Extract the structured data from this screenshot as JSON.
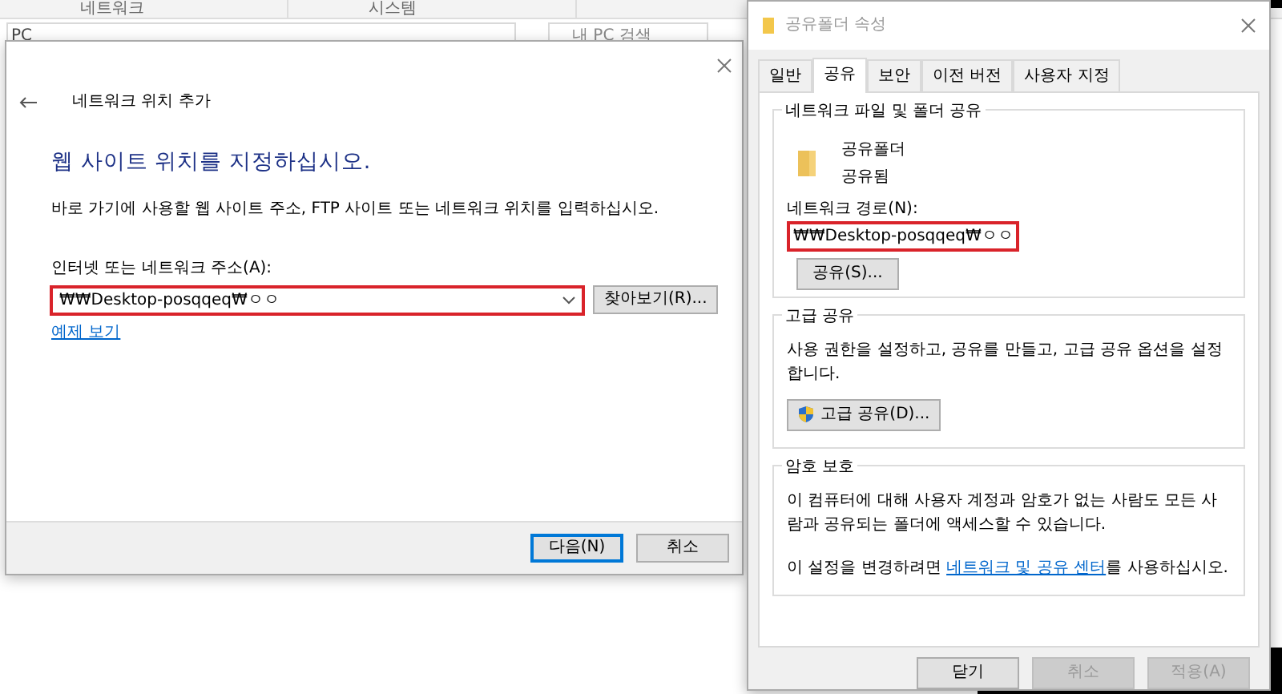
{
  "background_window": {
    "columns": [
      "네트워크",
      "시스템"
    ],
    "address": "PC",
    "search_placeholder": "내 PC 검색"
  },
  "add_location_dialog": {
    "header": "네트워크 위치 추가",
    "heading": "웹 사이트 위치를 지정하십시오.",
    "description": "바로 가기에 사용할 웹 사이트 주소, FTP 사이트 또는 네트워크 위치를 입력하십시오.",
    "address_label": "인터넷 또는 네트워크 주소(A):",
    "address_value": "₩₩Desktop-posqqeq₩ㅇㅇ",
    "address_highlighted": true,
    "browse_button": "찾아보기(R)...",
    "example_link": "예제 보기",
    "buttons": [
      {
        "label": "다음(N)",
        "default": true
      },
      {
        "label": "취소",
        "default": false
      }
    ]
  },
  "properties_dialog": {
    "title": "공유폴더 속성",
    "tabs": [
      {
        "label": "일반",
        "selected": false
      },
      {
        "label": "공유",
        "selected": true
      },
      {
        "label": "보안",
        "selected": false
      },
      {
        "label": "이전 버전",
        "selected": false
      },
      {
        "label": "사용자 지정",
        "selected": false
      }
    ],
    "network_sharing": {
      "title": "네트워크 파일 및 폴더 공유",
      "folder_name": "공유폴더",
      "status": "공유됨",
      "path_label": "네트워크 경로(N):",
      "path": "₩₩Desktop-posqqeq₩ㅇㅇ",
      "path_highlighted": true,
      "button": "공유(S)..."
    },
    "advanced_sharing": {
      "title": "고급 공유",
      "description": "사용 권한을 설정하고, 공유를 만들고, 고급 공유 옵션을 설정합니다.",
      "button": "고급 공유(D)..."
    },
    "password_protection": {
      "title": "암호 보호",
      "description": "이 컴퓨터에 대해 사용자 계정과 암호가 없는 사람도 모든 사람과 공유되는 폴더에 액세스할 수 있습니다.",
      "sentence_before": "이 설정을 변경하려면 ",
      "link": "네트워크 및 공유 센터",
      "sentence_after": "를 사용하십시오."
    },
    "buttons": [
      {
        "label": "닫기",
        "disabled": false
      },
      {
        "label": "취소",
        "disabled": true
      },
      {
        "label": "적용(A)",
        "disabled": true
      }
    ]
  }
}
